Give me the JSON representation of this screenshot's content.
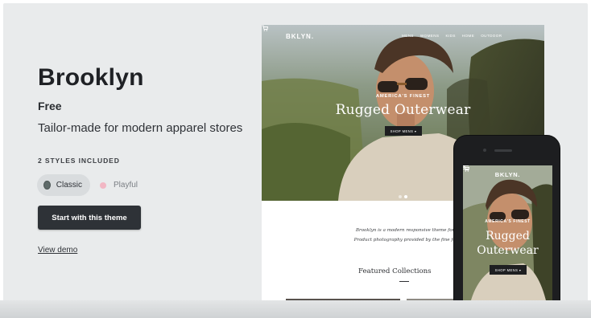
{
  "theme": {
    "name": "Brooklyn",
    "price": "Free",
    "tagline": "Tailor-made for modern apparel stores",
    "styles_heading": "2 STYLES INCLUDED",
    "styles": [
      {
        "label": "Classic",
        "color": "#5f6b6a",
        "selected": true
      },
      {
        "label": "Playful",
        "color": "#f2b7c4",
        "selected": false
      }
    ],
    "cta_label": "Start with this theme",
    "demo_link": "View demo"
  },
  "desktop_preview": {
    "logo": "BKLYN.",
    "nav": [
      "MENS",
      "WOMENS",
      "KIDS",
      "HOME",
      "OUTDOOR"
    ],
    "hero_kicker": "AMERICA'S FINEST",
    "hero_title": "Rugged Outerwear",
    "hero_button": "SHOP MENS ▾",
    "intro_line1": "Brooklyn is a modern responsive theme for your Sh",
    "intro_line2": "Product photography provided by the fine folks at Ur",
    "featured_heading": "Featured Collections"
  },
  "mobile_preview": {
    "logo": "BKLYN.",
    "hero_kicker": "AMERICA'S FINEST",
    "hero_title_line1": "Rugged",
    "hero_title_line2": "Outerwear",
    "hero_button": "SHOP MENS ▾"
  },
  "icons": [
    "cart-icon",
    "menu-icon"
  ]
}
